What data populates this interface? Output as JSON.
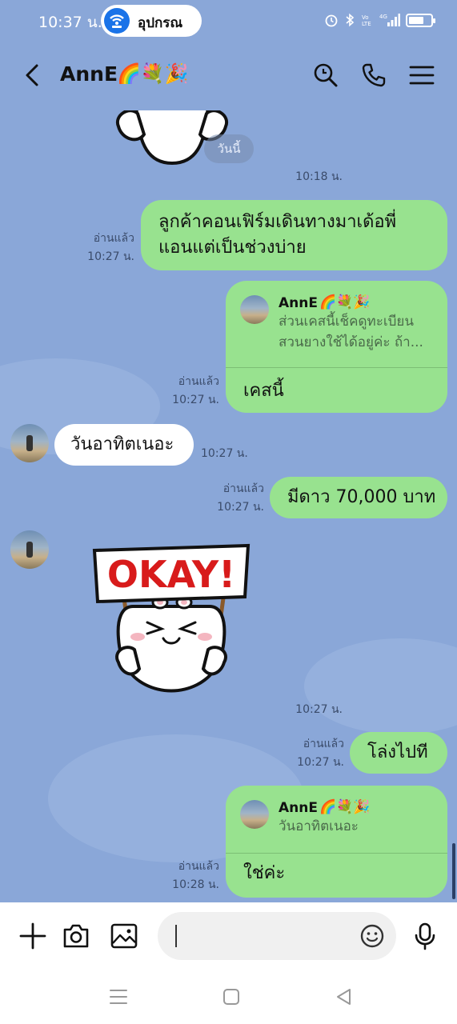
{
  "status_bar": {
    "time": "10:37 น.",
    "pill_label": "อุปกรณ",
    "battery_level": 0.7
  },
  "header": {
    "name": "AnnE",
    "emoji": "🌈💐🎉"
  },
  "chat": {
    "date_chip": "วันนี้",
    "messages": [
      {
        "id": "m1",
        "type": "sticker",
        "direction": "in",
        "time": "10:18 น."
      },
      {
        "id": "m2",
        "type": "text",
        "direction": "out",
        "read": "อ่านแล้ว",
        "time": "10:27 น.",
        "lines": [
          "ลูกค้าคอนเฟิร์มเดินทางมาเด้อพี่",
          "แอนแต่เป็นช่วงบ่าย"
        ]
      },
      {
        "id": "m3",
        "type": "reply",
        "direction": "out",
        "read": "อ่านแล้ว",
        "time": "10:27 น.",
        "quote_name": "AnnE",
        "quote_emoji": "🌈💐🎉",
        "quote_lines": [
          "ส่วนเคสนี้เช็คดูทะเบียน",
          "สวนยางใช้ได้อยู่ค่ะ ถ้า..."
        ],
        "text": "เคสนี้"
      },
      {
        "id": "m4",
        "type": "text",
        "direction": "in",
        "time": "10:27 น.",
        "text": "วันอาทิตเนอะ"
      },
      {
        "id": "m5",
        "type": "text",
        "direction": "out",
        "read": "อ่านแล้ว",
        "time": "10:27 น.",
        "text": "มีดาว 70,000 บาท"
      },
      {
        "id": "m6",
        "type": "sticker",
        "direction": "in",
        "time": "10:27 น.",
        "sign_text": "OKAY!"
      },
      {
        "id": "m7",
        "type": "text",
        "direction": "out",
        "read": "อ่านแล้ว",
        "time": "10:27 น.",
        "text": "โล่งไปที"
      },
      {
        "id": "m8",
        "type": "reply",
        "direction": "out",
        "read": "อ่านแล้ว",
        "time": "10:28 น.",
        "quote_name": "AnnE",
        "quote_emoji": "🌈💐🎉",
        "quote_lines": [
          "วันอาทิตเนอะ"
        ],
        "text": "ใช่ค่ะ"
      }
    ]
  },
  "input": {
    "placeholder": ""
  },
  "icons": {
    "back": "back-arrow-icon",
    "search": "search-icon",
    "call": "phone-icon",
    "menu": "menu-icon",
    "add": "plus-icon",
    "camera": "camera-icon",
    "gallery": "image-icon",
    "emoji": "smiley-icon",
    "mic": "microphone-icon"
  },
  "colors": {
    "background": "#8aa7d8",
    "outgoing_bubble": "#98e28f",
    "incoming_bubble": "#ffffff"
  }
}
